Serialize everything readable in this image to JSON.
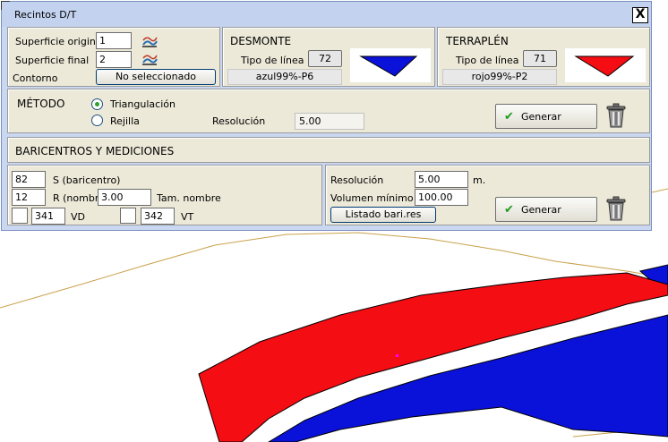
{
  "window": {
    "title": "Recintos D/T",
    "close_glyph": "X"
  },
  "surface": {
    "original_label": "Superficie original",
    "original_value": "1",
    "final_label": "Superficie final",
    "final_value": "2",
    "contorno_label": "Contorno",
    "contorno_button": "No seleccionado"
  },
  "desmonte": {
    "header": "DESMONTE",
    "line_type_label": "Tipo de línea",
    "line_type_value": "72",
    "color_name": "azul99%-P6",
    "swatch_color": "#0a11d9"
  },
  "terraplen": {
    "header": "TERRAPLÉN",
    "line_type_label": "Tipo de línea",
    "line_type_value": "71",
    "color_name": "rojo99%-P2",
    "swatch_color": "#f50d14"
  },
  "metodo": {
    "header": "MÉTODO",
    "option_triangulacion": "Triangulación",
    "option_rejilla": "Rejilla",
    "selected": "Triangulación",
    "resolution_label": "Resolución",
    "resolution_value": "5.00",
    "generate_button": "Generar"
  },
  "baricentros": {
    "header": "BARICENTROS Y MEDICIONES",
    "s_value": "82",
    "s_label": "S (baricentro)",
    "r_value": "12",
    "r_label": "R (nombre",
    "tam_value": "3.00",
    "tam_label": "Tam. nombre",
    "vd_value": "341",
    "vd_label": "VD",
    "vt_value": "342",
    "vt_label": "VT",
    "resolution_label": "Resolución",
    "resolution_value": "5.00",
    "resolution_unit": "m.",
    "min_volume_label": "Volumen mínimo",
    "min_volume_value": "100.00",
    "list_button": "Listado bari.res",
    "generate_button": "Generar"
  },
  "canvas": {
    "fill_cut": "#0a11d9",
    "fill_fill": "#f50d14",
    "contour_color": "#c8a24a"
  }
}
